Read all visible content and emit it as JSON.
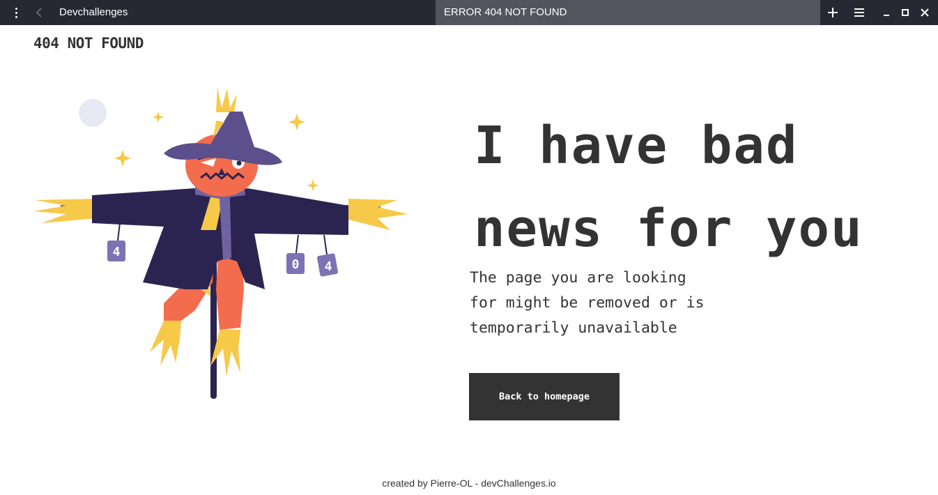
{
  "titlebar": {
    "app_name": "Devchallenges",
    "tab_title": "ERROR 404 NOT FOUND",
    "icons": [
      "kebab-menu-icon",
      "back-arrow-icon",
      "plus-icon",
      "hamburger-icon",
      "minimize-icon",
      "maximize-icon",
      "close-icon"
    ]
  },
  "header": {
    "logo_text": "404 NOT FOUND"
  },
  "hero": {
    "headline_line1": "I have bad",
    "headline_line2": "news for you",
    "message_lines": [
      "The page you are looking",
      "for might be removed or is",
      "temporarily unavailable"
    ],
    "button_label": "Back to homepage"
  },
  "illustration": {
    "can_labels": [
      "4",
      "0",
      "4"
    ]
  },
  "footer": {
    "credit": "created by Pierre-OL - devChallenges.io"
  },
  "colors": {
    "titlebar_bg": "#262933",
    "active_tab_bg": "#52555e",
    "text": "#333333",
    "button_bg": "#333333",
    "scarecrow_face": "#f46c4e",
    "scarecrow_hat": "#5b4f8c",
    "scarecrow_coat": "#2c2450",
    "straw": "#f7c948"
  }
}
